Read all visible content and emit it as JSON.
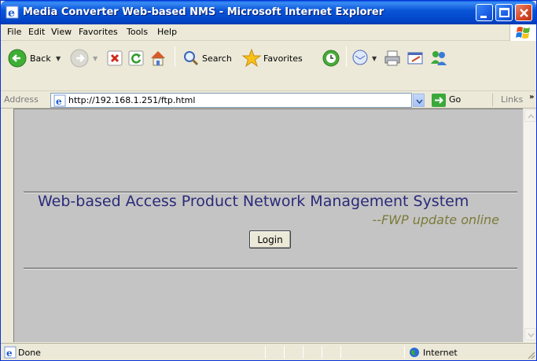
{
  "window": {
    "title": "Media Converter Web-based NMS - Microsoft Internet Explorer"
  },
  "menu": {
    "items": [
      "File",
      "Edit",
      "View",
      "Favorites",
      "Tools",
      "Help"
    ]
  },
  "toolbar": {
    "back_label": "Back",
    "search_label": "Search",
    "favorites_label": "Favorites"
  },
  "address": {
    "label": "Address",
    "url": "http://192.168.1.251/ftp.html",
    "go_label": "Go",
    "links_label": "Links",
    "links_chevron": "»"
  },
  "page": {
    "title": "Web-based Access Product Network Management System",
    "subtitle": "--FWP update online",
    "login_label": "Login"
  },
  "status": {
    "text": "Done",
    "zone": "Internet"
  }
}
